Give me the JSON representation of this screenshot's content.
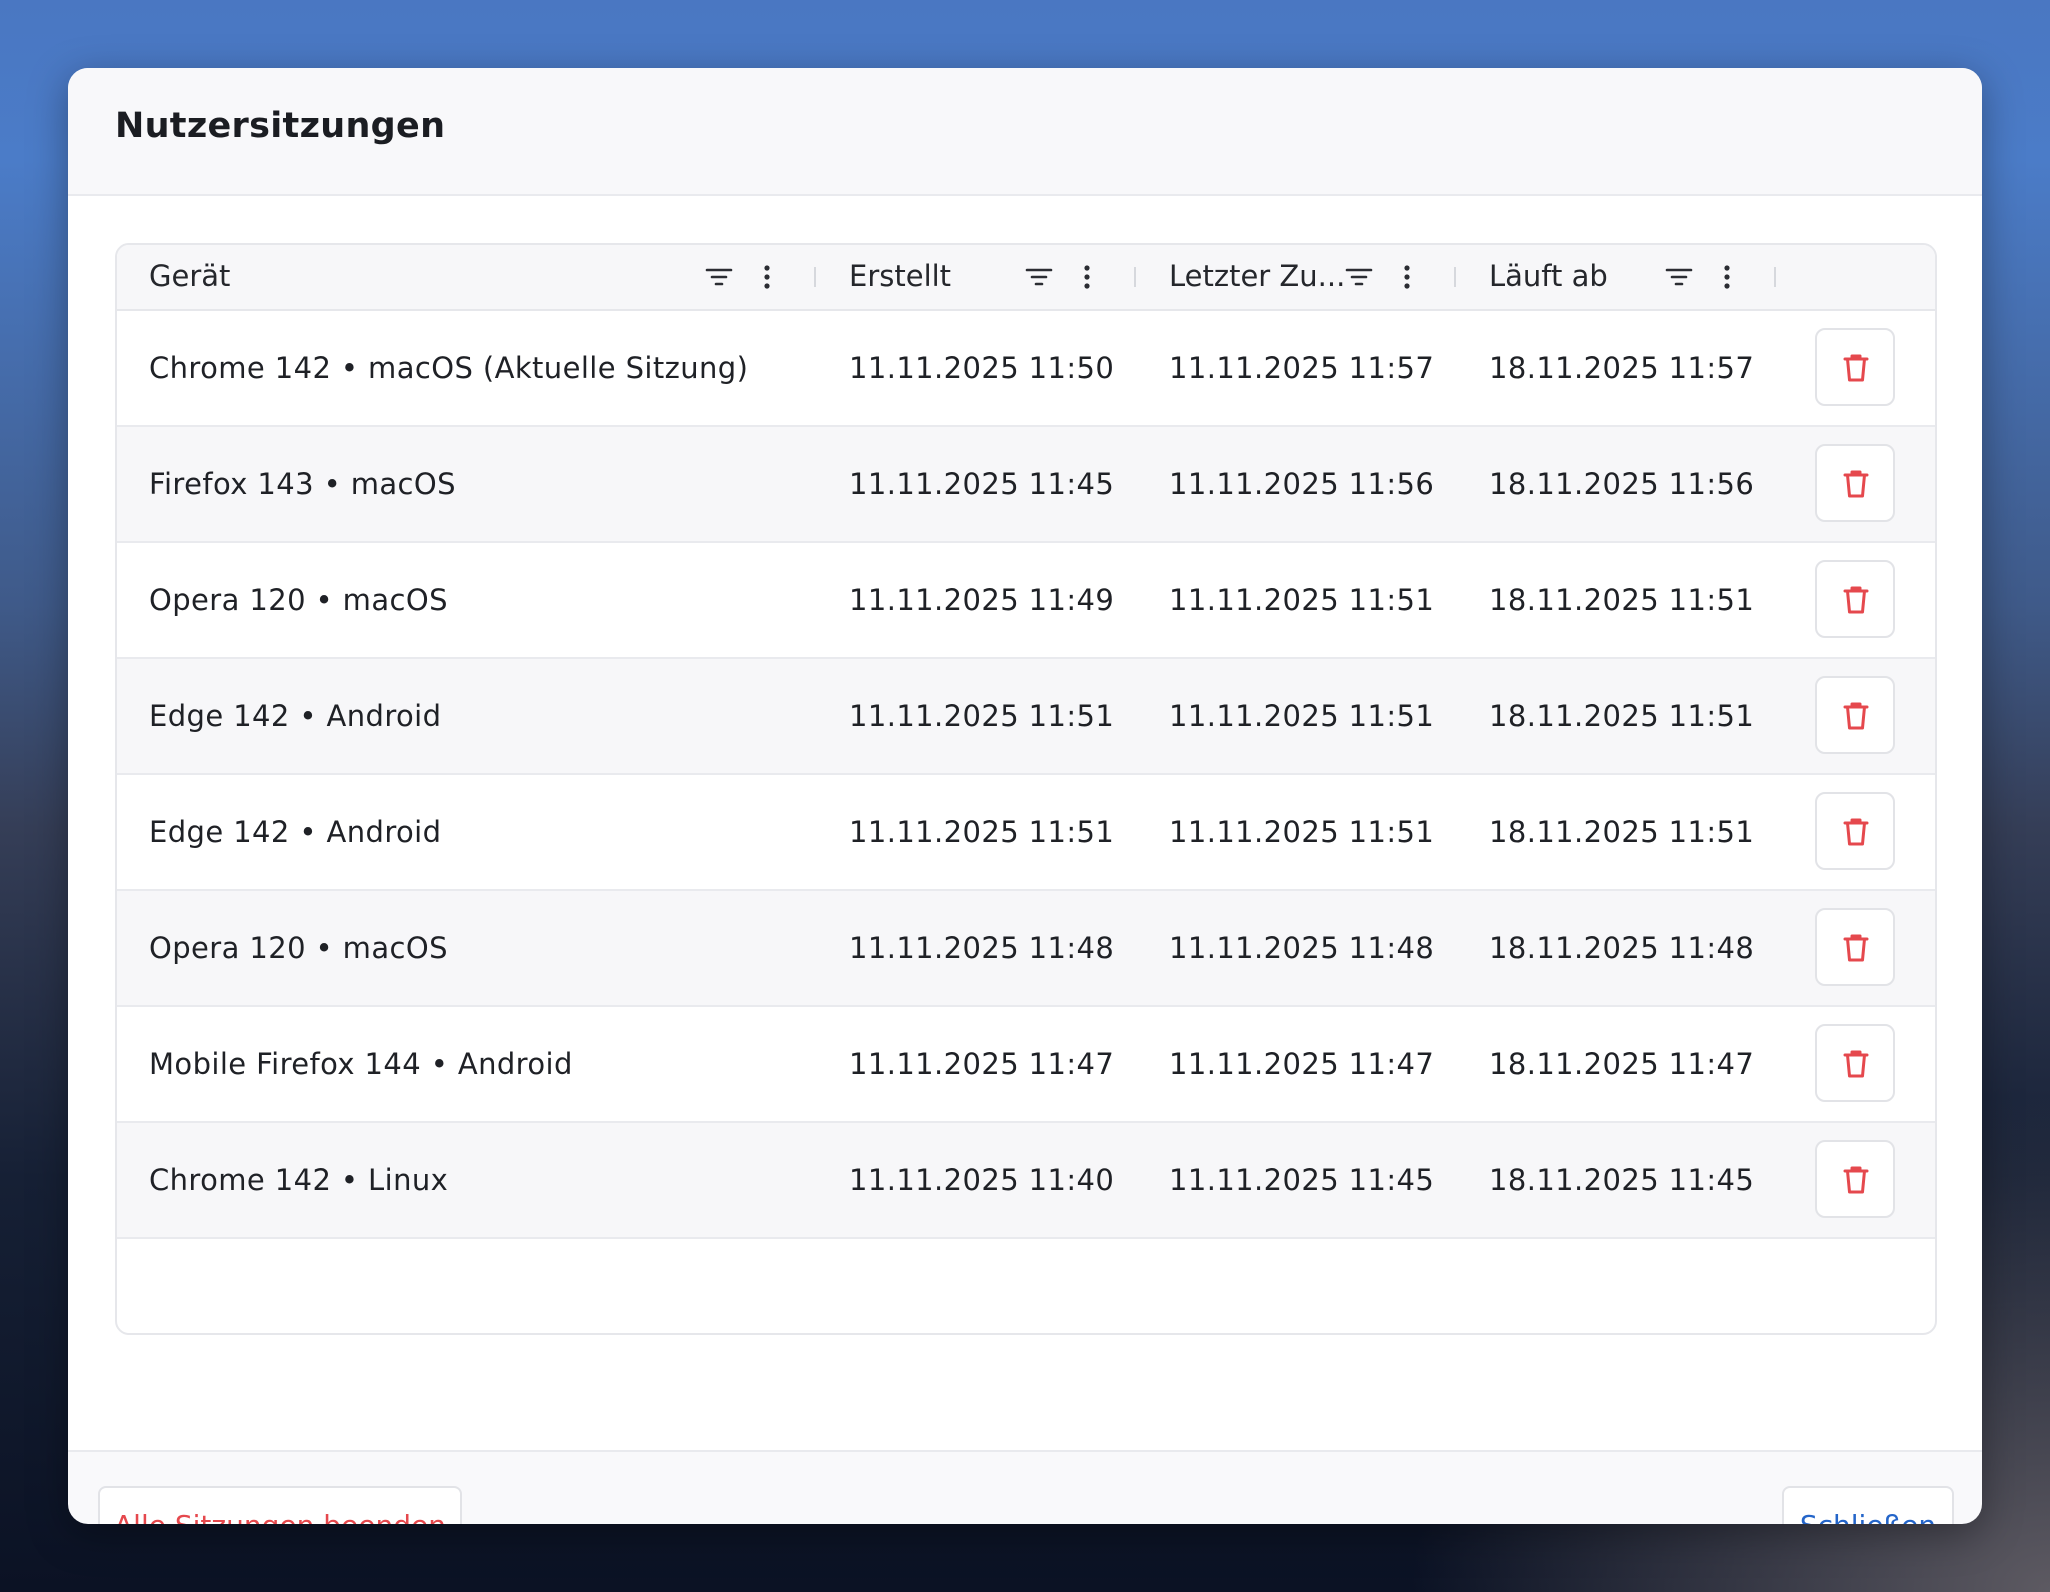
{
  "dialog": {
    "title": "Nutzersitzungen"
  },
  "table": {
    "columns": [
      {
        "label": "Gerät"
      },
      {
        "label": "Erstellt"
      },
      {
        "label": "Letzter Zu..."
      },
      {
        "label": "Läuft ab"
      }
    ],
    "rows": [
      {
        "device": "Chrome 142 • macOS (Aktuelle Sitzung)",
        "created": "11.11.2025 11:50",
        "last_access": "11.11.2025 11:57",
        "expires": "18.11.2025 11:57"
      },
      {
        "device": "Firefox 143 • macOS",
        "created": "11.11.2025 11:45",
        "last_access": "11.11.2025 11:56",
        "expires": "18.11.2025 11:56"
      },
      {
        "device": "Opera 120 • macOS",
        "created": "11.11.2025 11:49",
        "last_access": "11.11.2025 11:51",
        "expires": "18.11.2025 11:51"
      },
      {
        "device": "Edge 142 • Android",
        "created": "11.11.2025 11:51",
        "last_access": "11.11.2025 11:51",
        "expires": "18.11.2025 11:51"
      },
      {
        "device": "Edge 142 • Android",
        "created": "11.11.2025 11:51",
        "last_access": "11.11.2025 11:51",
        "expires": "18.11.2025 11:51"
      },
      {
        "device": "Opera 120 • macOS",
        "created": "11.11.2025 11:48",
        "last_access": "11.11.2025 11:48",
        "expires": "18.11.2025 11:48"
      },
      {
        "device": "Mobile Firefox 144 • Android",
        "created": "11.11.2025 11:47",
        "last_access": "11.11.2025 11:47",
        "expires": "18.11.2025 11:47"
      },
      {
        "device": "Chrome 142 • Linux",
        "created": "11.11.2025 11:40",
        "last_access": "11.11.2025 11:45",
        "expires": "18.11.2025 11:45"
      }
    ]
  },
  "icons": {
    "filter": "filter-icon",
    "menu": "more-vertical-icon",
    "delete": "trash-icon"
  },
  "footer": {
    "end_all_label": "Alle Sitzungen beenden",
    "close_label": "Schließen"
  },
  "colors": {
    "danger": "#e5484d",
    "primary": "#2465c9"
  }
}
